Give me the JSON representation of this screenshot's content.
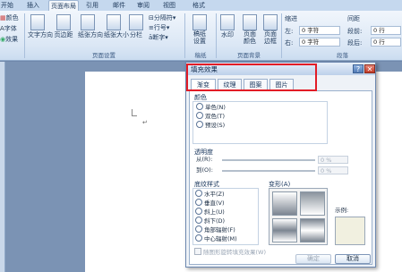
{
  "ribbon": {
    "tabs": [
      {
        "label": "开始",
        "active": false
      },
      {
        "label": "插入",
        "active": false
      },
      {
        "label": "页面布局",
        "active": true
      },
      {
        "label": "引用",
        "active": false
      },
      {
        "label": "邮件",
        "active": false
      },
      {
        "label": "审阅",
        "active": false
      },
      {
        "label": "视图",
        "active": false
      },
      {
        "label": "格式",
        "active": false
      }
    ],
    "theme_items": [
      "颜色",
      "字体",
      "效果"
    ],
    "page_setup": {
      "buttons": [
        "文字方向",
        "页边距",
        "纸张方向",
        "纸张大小",
        "分栏"
      ],
      "small_items": [
        "分隔符",
        "行号",
        "断字"
      ],
      "group_label": "页面设置"
    },
    "manuscript": {
      "button": "稿纸设置",
      "group_label": "稿纸"
    },
    "page_background": {
      "buttons": [
        "水印",
        "页面颜色",
        "页面边框"
      ],
      "group_label": "页面背景"
    },
    "paragraph": {
      "indent_label": "缩进",
      "spacing_label": "间距",
      "left_label": "左:",
      "right_label": "右:",
      "before_label": "段前:",
      "after_label": "段后:",
      "left_value": "0 字符",
      "right_value": "0 字符",
      "before_value": "0 行",
      "after_value": "0 行",
      "group_label": "段落"
    }
  },
  "dialog": {
    "title": "填充效果",
    "help_icon": "?",
    "close_icon": "✕",
    "tabs": [
      {
        "label": "渐变",
        "active": true
      },
      {
        "label": "纹理",
        "active": false
      },
      {
        "label": "图案",
        "active": false
      },
      {
        "label": "图片",
        "active": false
      }
    ],
    "colors": {
      "label": "颜色",
      "options": [
        "单色(N)",
        "双色(T)",
        "预设(S)"
      ]
    },
    "transparency": {
      "label": "透明度",
      "from_label": "从(R):",
      "to_label": "到(O):",
      "from_value": "0 %",
      "to_value": "0 %"
    },
    "shading": {
      "label": "底纹样式",
      "options": [
        "水平(Z)",
        "垂直(V)",
        "斜上(U)",
        "斜下(D)",
        "角部辐射(F)",
        "中心辐射(M)"
      ]
    },
    "variants_label": "变形(A)",
    "sample_label": "示例:",
    "rotate_label": "随图形旋转填充效果(W)",
    "ok_label": "确定",
    "cancel_label": "取消",
    "colors_hex": {
      "highlight": "#e21c26",
      "sample": "#f1f0e0"
    }
  }
}
